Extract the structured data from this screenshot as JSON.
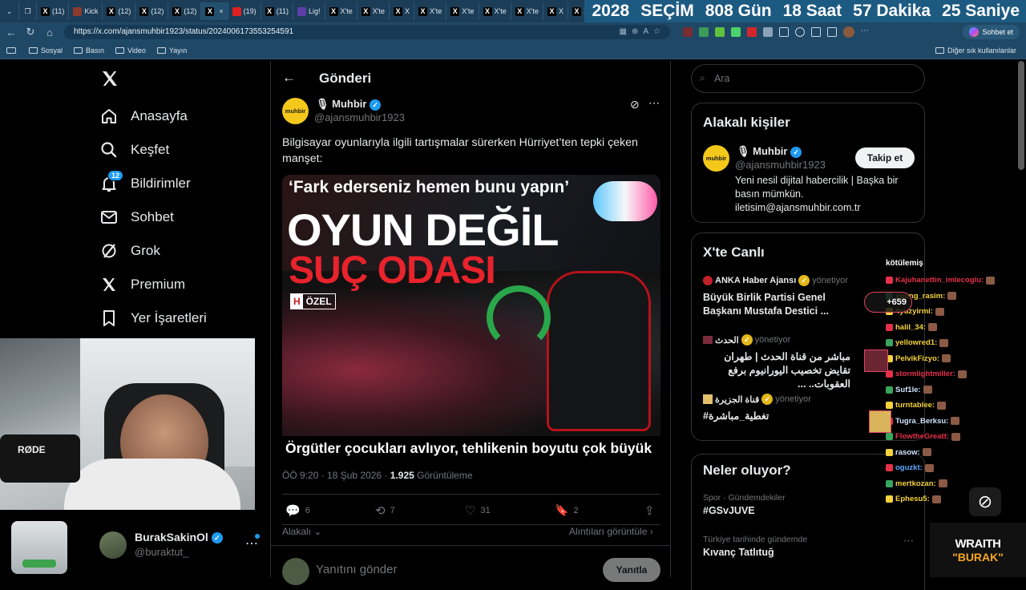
{
  "browser": {
    "tabs": [
      "(11)",
      "Kick",
      "(12)",
      "(12)",
      "(12)",
      "",
      "(19)",
      "(11)",
      "Lig!",
      "X'te",
      "X'te",
      "X",
      "X'te",
      "X'te",
      "X'te",
      "X'te",
      "X",
      "X'te",
      "X'te"
    ],
    "active_tab_index": 5,
    "countdown": {
      "year": "2028",
      "label": "SEÇİM",
      "days": "808 Gün",
      "hours": "18 Saat",
      "minutes": "57 Dakika",
      "seconds": "25 Saniye"
    },
    "url": "https://x.com/ajansmuhbir1923/status/2024006173553254591",
    "copilot_label": "Sohbet et",
    "bookmarks": [
      "Sosyal",
      "Basın",
      "Video",
      "Yayın"
    ],
    "other_bookmarks": "Diğer sık kullanılanlar"
  },
  "nav": {
    "items": [
      {
        "label": "Anasayfa",
        "icon": "home-icon"
      },
      {
        "label": "Keşfet",
        "icon": "search-icon"
      },
      {
        "label": "Bildirimler",
        "icon": "bell-icon",
        "badge": "12"
      },
      {
        "label": "Sohbet",
        "icon": "mail-icon"
      },
      {
        "label": "Grok",
        "icon": "grok-icon"
      },
      {
        "label": "Premium",
        "icon": "x-icon"
      },
      {
        "label": "Yer İşaretleri",
        "icon": "bookmark-icon"
      }
    ],
    "account": {
      "name": "BurakSakinOl",
      "handle": "@buraktut_"
    }
  },
  "post": {
    "header": "Gönderi",
    "author": {
      "name": "Muhbir",
      "handle": "@ajansmuhbir1923",
      "avatar_text": "muhbir"
    },
    "text": "Bilgisayar oyunlarıyla ilgili tartışmalar sürerken Hürriyet’ten tepki çeken manşet:",
    "image": {
      "quote": "‘Fark ederseniz hemen bunu yapın’",
      "headline1": "OYUN DEĞİL",
      "headline2": "SUÇ ODASI",
      "tag": "ÖZEL",
      "tag_letter": "H",
      "caption": "Örgütler çocukları avlıyor, tehlikenin boyutu çok büyük"
    },
    "time": "ÖÖ 9:20 · 18 Şub 2026 ·",
    "views_count": "1.925",
    "views_label": "Görüntüleme",
    "stats": {
      "replies": "6",
      "reposts": "7",
      "likes": "31",
      "bookmarks": "2"
    },
    "relevant_label": "Alakalı",
    "quotes_label": "Alıntıları görüntüle",
    "reply_placeholder": "Yanıtını gönder",
    "reply_button": "Yanıtla"
  },
  "sidebar": {
    "search_placeholder": "Ara",
    "related": {
      "title": "Alakalı kişiler",
      "name": "Muhbir",
      "handle": "@ajansmuhbir1923",
      "bio": "Yeni nesil dijital habercilik | Başka bir basın mümkün. iletisim@ajansmuhbir.com.tr",
      "follow": "Takip et"
    },
    "live": {
      "title": "X'te Canlı",
      "items": [
        {
          "source": "ANKA Haber Ajansı",
          "status": "yönetiyor",
          "text": "Büyük Birlik Partisi Genel Başkanı Mustafa Destici ..."
        },
        {
          "source": "الحدث",
          "status": "yönetiyor",
          "text": "مباشر من قناة الحدث | طهران تقايض تخصيب اليورانيوم برفع العقوبات.. ..."
        },
        {
          "source": "قناة الجزيرة",
          "status": "yönetiyor",
          "text": "#تغطية_مباشرة"
        }
      ],
      "plus_count": "+659"
    },
    "trends": {
      "title": "Neler oluyor?",
      "items": [
        {
          "meta": "Spor · Gündemdekiler",
          "name": "#GSvJUVE"
        },
        {
          "meta": "Türkiye tarihinde gündemde",
          "name": "Kıvanç Tatlıtuğ"
        }
      ]
    }
  },
  "stream_chat": {
    "header": "kötülemiş",
    "lines": [
      {
        "user": "Kajuhanettin_imlecoglu:",
        "color": "#e6304a"
      },
      {
        "user": "young_rasim:",
        "color": "#f5d33c"
      },
      {
        "user": "4yuzyirmi:",
        "color": "#f5d33c"
      },
      {
        "user": "halil_34:",
        "color": "#f5d33c"
      },
      {
        "user": "yellowred1:",
        "color": "#f5d33c"
      },
      {
        "user": "PelvikFizyo:",
        "color": "#f5d33c"
      },
      {
        "user": "stormlightmiller:",
        "color": "#e6304a"
      },
      {
        "user": "Suf1le:",
        "color": "#cfe3ff"
      },
      {
        "user": "turntablee:",
        "color": "#f5d33c"
      },
      {
        "user": "Tugra_Berksu:",
        "color": "#cfe3ff"
      },
      {
        "user": "FlowtheGreatt:",
        "color": "#e6304a"
      },
      {
        "user": "rasow:",
        "color": "#cfe3ff"
      },
      {
        "user": "oguzkt:",
        "color": "#5ea8ff"
      },
      {
        "user": "mertkozan:",
        "color": "#f5d33c"
      },
      {
        "user": "Ephesu5:",
        "color": "#f5d33c"
      }
    ]
  },
  "overlay": {
    "brand_top": "WRAITH",
    "brand_bottom": "\"BURAK\"",
    "mic_label": "RØDE"
  }
}
